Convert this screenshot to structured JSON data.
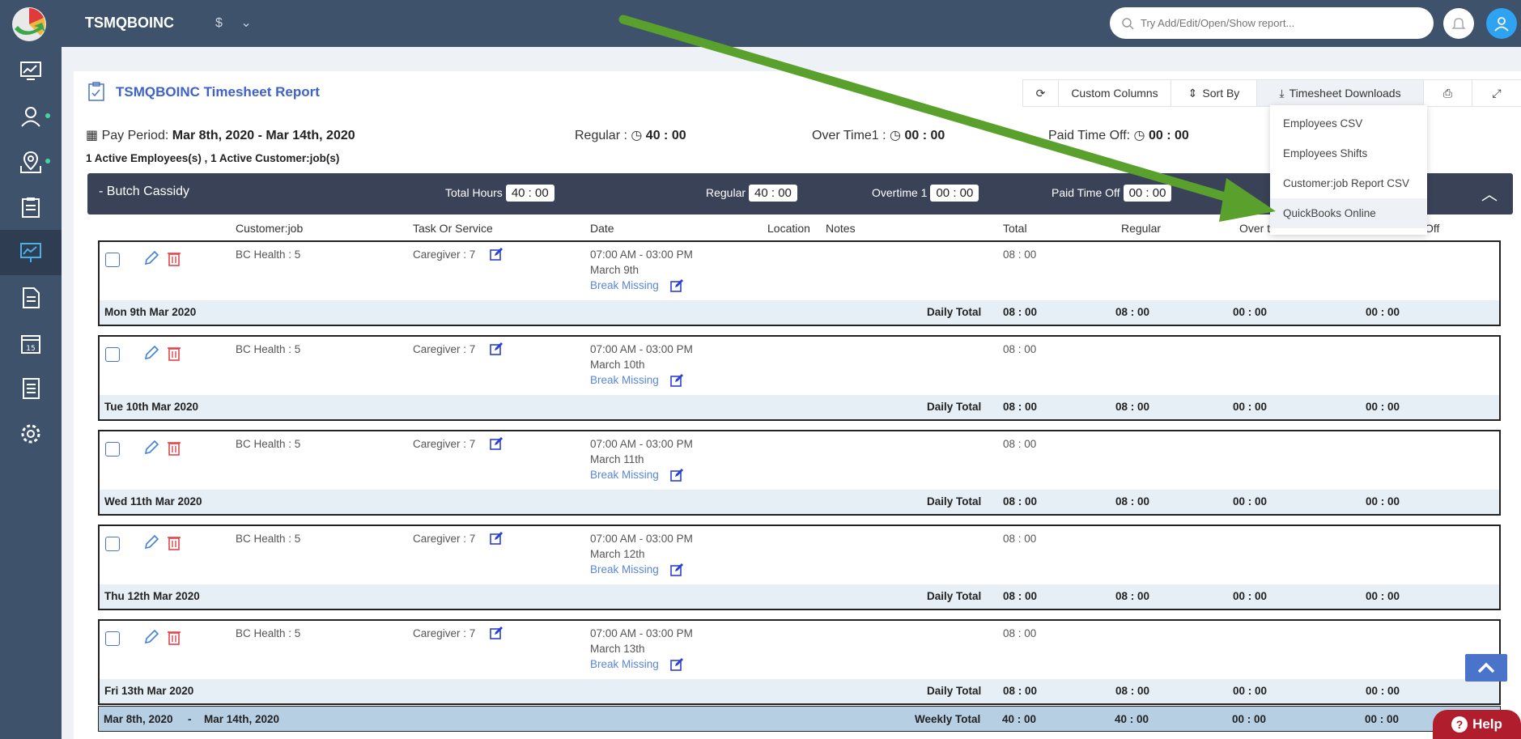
{
  "topbar": {
    "company": "TSMQBOINC",
    "currency_symbol": "$",
    "search_placeholder": "Try Add/Edit/Open/Show report..."
  },
  "report": {
    "title": "TSMQBOINC Timesheet Report",
    "pay_period_label": "Pay Period:",
    "pay_period": "Mar 8th, 2020 - Mar 14th, 2020",
    "regular_label": "Regular :",
    "regular": "40 : 00",
    "overtime_label": "Over Time1 :",
    "overtime": "00 : 00",
    "pto_label": "Paid Time Off:",
    "pto": "00 : 00",
    "active_summary": "1 Active Employees(s) , 1 Active Customer:job(s)"
  },
  "toolbar": {
    "custom_columns": "Custom Columns",
    "sort_by": "Sort By",
    "downloads": "Timesheet Downloads"
  },
  "downloads_menu": [
    "Employees CSV",
    "Employees Shifts",
    "Customer:job Report CSV",
    "QuickBooks Online"
  ],
  "employee": {
    "name": "- Butch Cassidy",
    "total_hours_label": "Total Hours",
    "total_hours": "40 : 00",
    "regular_label": "Regular",
    "regular": "40 : 00",
    "overtime_label": "Overtime 1",
    "overtime": "00 : 00",
    "pto_label": "Paid Time Off",
    "pto": "00 : 00"
  },
  "columns": {
    "customer_job": "Customer:job",
    "task": "Task Or Service",
    "date": "Date",
    "location": "Location",
    "notes": "Notes",
    "total": "Total",
    "regular": "Regular",
    "overtime": "Over t",
    "pto": "Off"
  },
  "days": [
    {
      "customer": "BC Health : 5",
      "task": "Caregiver : 7",
      "time": "07:00 AM - 03:00 PM",
      "date": "March 9th",
      "break": "Break Missing",
      "total": "08 : 00",
      "label": "Mon 9th Mar 2020",
      "daily_label": "Daily Total",
      "d_total": "08 : 00",
      "d_regular": "08 : 00",
      "d_ot": "00 : 00",
      "d_pto": "00 : 00"
    },
    {
      "customer": "BC Health : 5",
      "task": "Caregiver : 7",
      "time": "07:00 AM - 03:00 PM",
      "date": "March 10th",
      "break": "Break Missing",
      "total": "08 : 00",
      "label": "Tue 10th Mar 2020",
      "daily_label": "Daily Total",
      "d_total": "08 : 00",
      "d_regular": "08 : 00",
      "d_ot": "00 : 00",
      "d_pto": "00 : 00"
    },
    {
      "customer": "BC Health : 5",
      "task": "Caregiver : 7",
      "time": "07:00 AM - 03:00 PM",
      "date": "March 11th",
      "break": "Break Missing",
      "total": "08 : 00",
      "label": "Wed 11th Mar 2020",
      "daily_label": "Daily Total",
      "d_total": "08 : 00",
      "d_regular": "08 : 00",
      "d_ot": "00 : 00",
      "d_pto": "00 : 00"
    },
    {
      "customer": "BC Health : 5",
      "task": "Caregiver : 7",
      "time": "07:00 AM - 03:00 PM",
      "date": "March 12th",
      "break": "Break Missing",
      "total": "08 : 00",
      "label": "Thu 12th Mar 2020",
      "daily_label": "Daily Total",
      "d_total": "08 : 00",
      "d_regular": "08 : 00",
      "d_ot": "00 : 00",
      "d_pto": "00 : 00"
    },
    {
      "customer": "BC Health : 5",
      "task": "Caregiver : 7",
      "time": "07:00 AM - 03:00 PM",
      "date": "March 13th",
      "break": "Break Missing",
      "total": "08 : 00",
      "label": "Fri 13th Mar 2020",
      "daily_label": "Daily Total",
      "d_total": "08 : 00",
      "d_regular": "08 : 00",
      "d_ot": "00 : 00",
      "d_pto": "00 : 00"
    }
  ],
  "weekly": {
    "range_start": "Mar 8th, 2020",
    "dash": "-",
    "range_end": "Mar 14th, 2020",
    "label": "Weekly Total",
    "total": "40 : 00",
    "regular": "40 : 00",
    "ot": "00 : 00",
    "pto": "00 : 00"
  },
  "help_label": "Help"
}
